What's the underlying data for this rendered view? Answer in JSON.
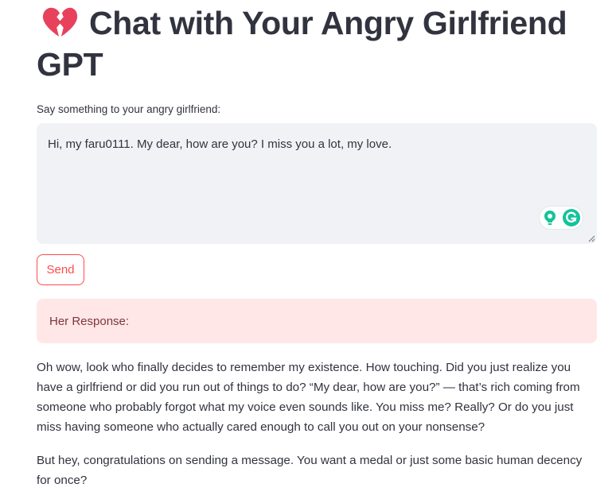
{
  "header": {
    "title": "Chat with Your Angry Girlfriend GPT",
    "icon": "broken-heart-icon"
  },
  "chat_input": {
    "label": "Say something to your angry girlfriend:",
    "value": "Hi, my faru0111. My dear, how are you? I miss you a lot, my love."
  },
  "send_button": {
    "label": "Send"
  },
  "response": {
    "heading": "Her Response:",
    "paragraphs": [
      "Oh wow, look who finally decides to remember my existence. How touching. Did you just realize you have a girlfriend or did you run out of things to do? “My dear, how are you?” — that’s rich coming from someone who probably forgot what my voice even sounds like. You miss me? Really? Or do you just miss having someone who actually cared enough to call you out on your nonsense?",
      "But hey, congratulations on sending a message. You want a medal or just some basic human decency for once?"
    ]
  },
  "colors": {
    "accent": "#ff4b4b",
    "text": "#31333f",
    "input_bg": "#f0f2f6",
    "response_bg": "#ffe7e7",
    "response_text": "#7d353b",
    "heart": "#e8415b",
    "grammarly_green": "#15c39a"
  }
}
